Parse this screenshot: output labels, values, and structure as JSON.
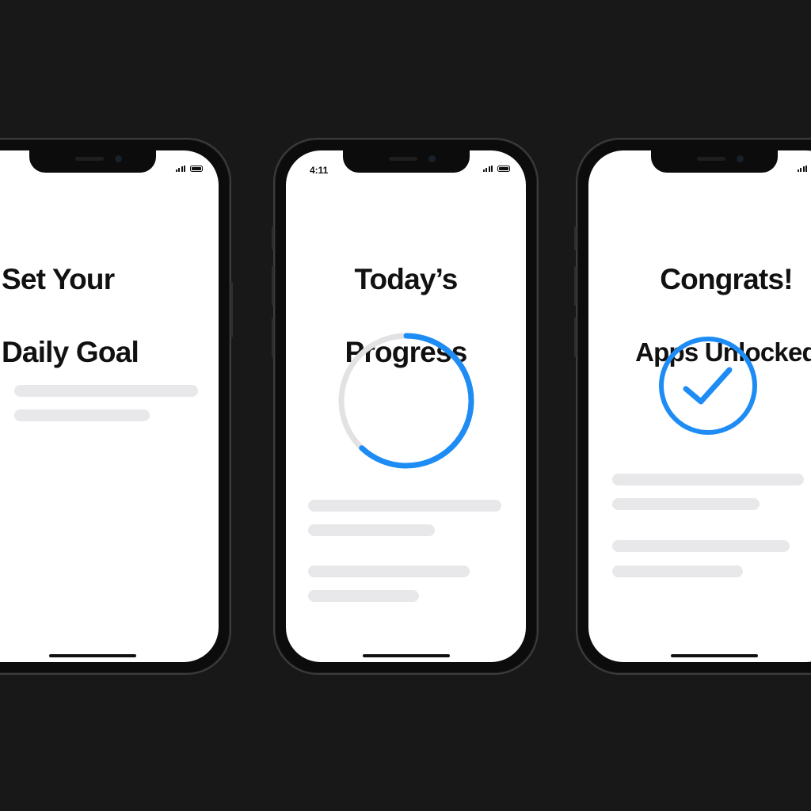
{
  "screens": [
    {
      "id": "set-goal",
      "status_time": "",
      "title_line1": "Set Your",
      "title_line2": "Daily Goal"
    },
    {
      "id": "todays-progress",
      "status_time": "4:11",
      "title_line1": "Today’s",
      "title_line2": "Progress",
      "progress_fraction": 0.62
    },
    {
      "id": "apps-unlocked",
      "status_time": "",
      "title_line1": "Congrats!",
      "title_line2": "Apps Unlocked"
    }
  ],
  "colors": {
    "accent": "#1e8cf5",
    "track": "#e2e2e4",
    "placeholder": "#e8e8ea",
    "background": "#181818"
  },
  "icons": [
    "signal-icon",
    "battery-icon",
    "checkmark-circle-icon",
    "progress-ring"
  ]
}
